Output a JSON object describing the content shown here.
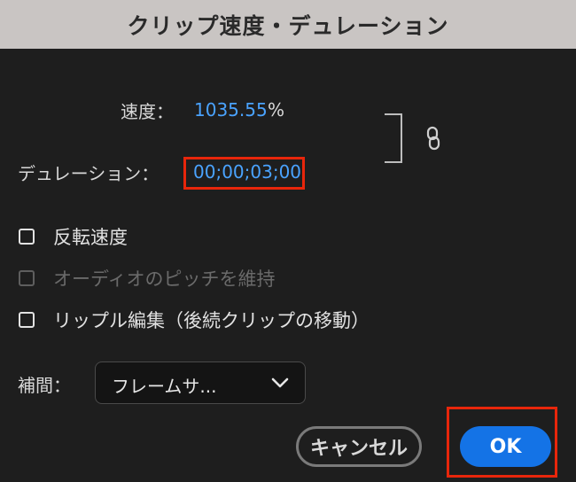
{
  "dialog": {
    "title": "クリップ速度・デュレーション"
  },
  "speed": {
    "label": "速度：",
    "value": "1035.55",
    "unit": "%"
  },
  "duration": {
    "label": "デュレーション：",
    "value": "00;00;03;00"
  },
  "checkboxes": [
    {
      "label": "反転速度",
      "checked": false,
      "enabled": true
    },
    {
      "label": "オーディオのピッチを維持",
      "checked": false,
      "enabled": false
    },
    {
      "label": "リップル編集（後続クリップの移動）",
      "checked": false,
      "enabled": true
    }
  ],
  "interpolation": {
    "label": "補間：",
    "selected": "フレームサ..."
  },
  "buttons": {
    "cancel": "キャンセル",
    "ok": "OK"
  },
  "colors": {
    "accent": "#1473e6",
    "value_text": "#4aa3ff",
    "highlight": "#e8260b"
  },
  "icons": {
    "link": "chain-link-icon",
    "dropdown": "chevron-down-icon"
  }
}
